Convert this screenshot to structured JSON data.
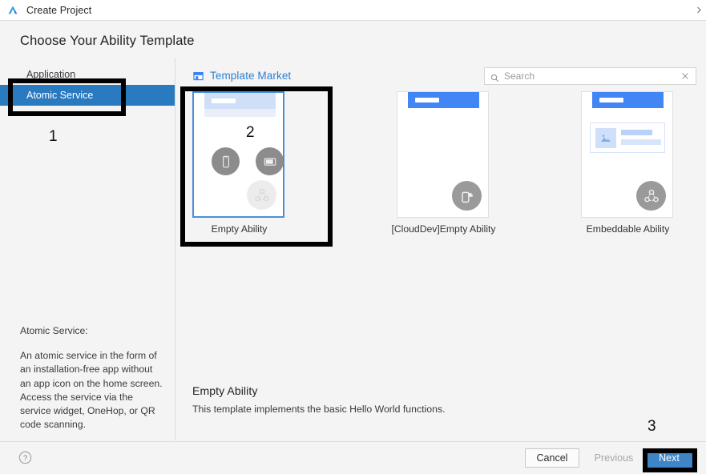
{
  "titlebar": {
    "title": "Create Project",
    "app_icon": "huawei-devEco-logo-icon",
    "expand_icon": "chevron-right-icon"
  },
  "heading": "Choose Your Ability Template",
  "sidebar": {
    "group_label": "Application",
    "items": [
      {
        "label": "Application",
        "selected": false
      },
      {
        "label": "Atomic Service",
        "selected": true
      }
    ],
    "description": {
      "title": "Atomic Service:",
      "body": "An atomic service in the form of an installation-free app without an app icon on the home screen. Access the service via the service widget, OneHop, or QR code scanning."
    }
  },
  "main": {
    "market_link": {
      "label": "Template Market",
      "icon": "store-icon"
    },
    "search": {
      "placeholder": "Search",
      "value": "",
      "search_icon": "search-icon",
      "clear_icon": "close-icon"
    },
    "templates": [
      {
        "label": "Empty Ability",
        "selected": true,
        "header_style": "pale",
        "badge": "share-nodes-icon",
        "badge_style": "faint",
        "device_icons": [
          "phone-icon",
          "tablet-icon"
        ]
      },
      {
        "label": "[CloudDev]Empty Ability",
        "selected": false,
        "header_style": "solid",
        "badge": "phone-cloud-icon",
        "badge_style": "gray",
        "device_icons": []
      },
      {
        "label": "Embeddable Ability",
        "selected": false,
        "header_style": "solid",
        "badge": "share-nodes-icon",
        "badge_style": "gray",
        "device_icons": []
      }
    ],
    "detail": {
      "title": "Empty Ability",
      "body": "This template implements the basic Hello World functions."
    }
  },
  "footer": {
    "help_icon": "question-circle-icon",
    "cancel_label": "Cancel",
    "previous_label": "Previous",
    "next_label": "Next"
  },
  "annotations": {
    "one": "1",
    "two": "2",
    "three": "3"
  },
  "colors": {
    "accent_blue": "#4285f4",
    "primary_button": "#3d85c6",
    "selection_blue": "#2a7ac0",
    "link_blue": "#2d7fd3",
    "panel_bg": "#f4f4f4",
    "annotation": "#000000"
  }
}
